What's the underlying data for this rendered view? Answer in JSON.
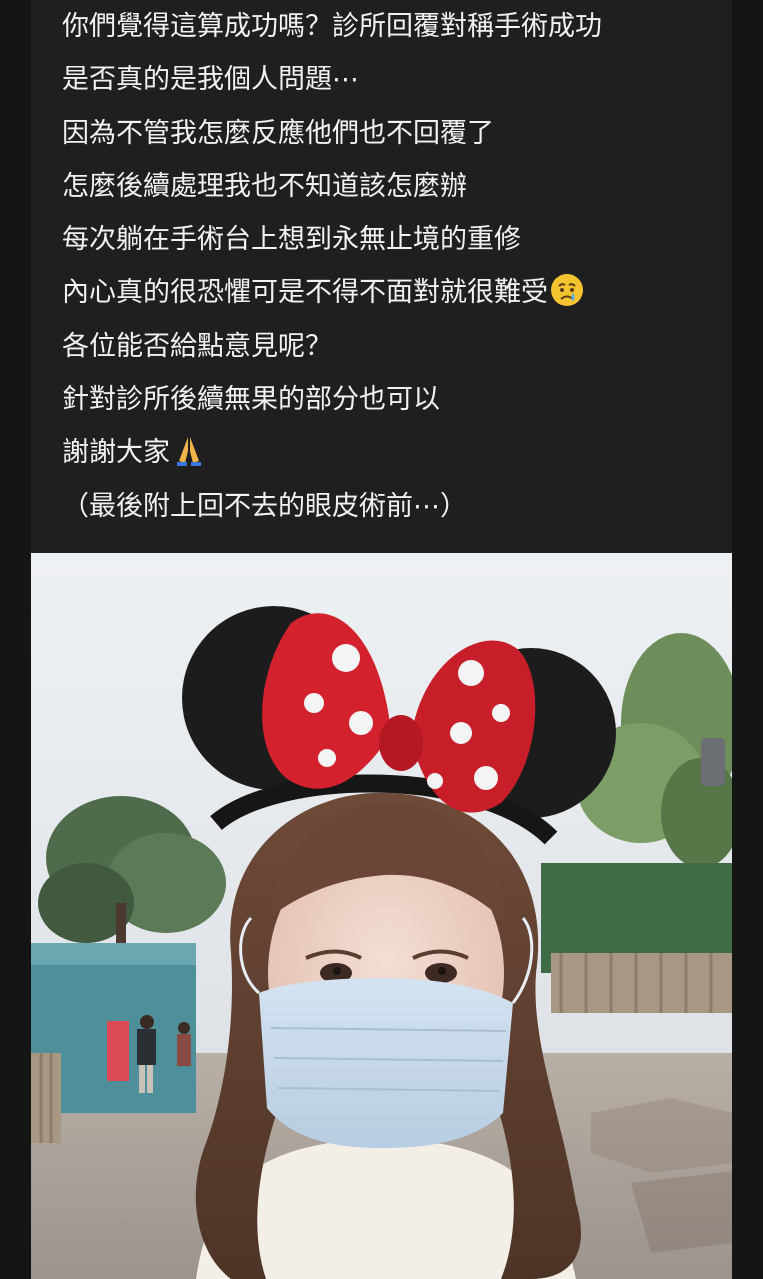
{
  "post": {
    "lines": [
      "你們覺得這算成功嗎？診所回覆對稱手術成功",
      "是否真的是我個人問題⋯",
      "因為不管我怎麼反應他們也不回覆了",
      "怎麼後續處理我也不知道該怎麼辦",
      "每次躺在手術台上想到永無止境的重修",
      "內心真的很恐懼可是不得不面對就很難受",
      "各位能否給點意見呢？",
      "針對診所後續無果的部分也可以",
      "謝謝大家",
      "（最後附上回不去的眼皮術前⋯）"
    ],
    "emojis": {
      "line6": "crying-face-emoji",
      "line9": "folded-hands-emoji"
    }
  },
  "photo": {
    "subject": "selfie-photo"
  }
}
